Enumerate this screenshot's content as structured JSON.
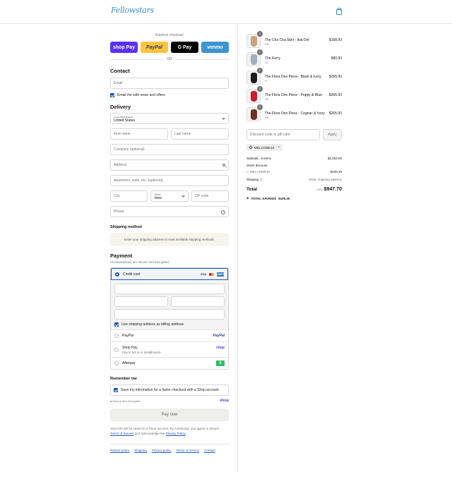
{
  "header": {
    "brand": "Fellowstars",
    "cart_icon": "shopping-bag-icon"
  },
  "express": {
    "label": "Express checkout",
    "or": "OR",
    "buttons": {
      "shop": "shop Pay",
      "paypal": "PayPal",
      "gpay": "G Pay",
      "venmo": "venmo"
    }
  },
  "contact": {
    "title": "Contact",
    "email_placeholder": "Email",
    "news_label": "Email me with news and offers"
  },
  "delivery": {
    "title": "Delivery",
    "country_label": "Country/Region",
    "country_value": "United States",
    "first_name": "First name",
    "last_name": "Last name",
    "company": "Company (optional)",
    "address": "Address",
    "apartment": "Apartment, suite, etc. (optional)",
    "city": "City",
    "state_label": "State",
    "state_value": "Iowa",
    "zip": "ZIP code",
    "phone": "Phone"
  },
  "shipping": {
    "title": "Shipping method",
    "info": "Enter your shipping address to view available shipping methods."
  },
  "payment": {
    "title": "Payment",
    "subtitle": "All transactions are secure and encrypted.",
    "credit_card": "Credit card",
    "cards": {
      "visa": "VISA",
      "amex": "AMEX"
    },
    "billing_label": "Use shipping address as billing address",
    "paypal": "PayPal",
    "paypal_logo": "PayPal",
    "shop_pay": "Shop Pay",
    "shop_pay_sub": "Pay in full or in installments",
    "shop_logo": "shop",
    "afterpay": "Afterpay",
    "afterpay_logo": "$"
  },
  "remember": {
    "title": "Remember me",
    "label": "Save my information for a faster checkout with a Shop account",
    "secure": "Secure and encrypted",
    "shop_logo": "shop"
  },
  "pay_now": "Pay now",
  "legal": {
    "text": "Your info will be saved to a Shop account. By continuing, you agree to Shop's",
    "tos": "Terms of Service",
    "and": "and acknowledge the",
    "privacy": "Privacy Policy",
    "dot": "."
  },
  "footer_links": [
    "Refund policy",
    "Shipping",
    "Privacy policy",
    "Terms of service",
    "Contact"
  ],
  "order": {
    "items": [
      {
        "name": "The Cha Cha Skirt - Ikat Dot",
        "variant": "XS",
        "price": "$168.00",
        "qty": "1",
        "color": "#c9a37a"
      },
      {
        "name": "The Kerry",
        "variant": "XL",
        "price": "$90.00",
        "qty": "1",
        "color": "#9fb0c3"
      },
      {
        "name": "The Flora One Piece - Black & Ivory",
        "variant": "S",
        "price": "$265.00",
        "qty": "1",
        "color": "#1b1b1b"
      },
      {
        "name": "The Flora One Piece - Poppy & Blue",
        "variant": "XS",
        "price": "$265.00",
        "qty": "1",
        "color": "#c8202a"
      },
      {
        "name": "The Flora One Piece - Cognac & Ivory",
        "variant": "XS",
        "price": "$265.00",
        "qty": "1",
        "color": "#6b3323"
      }
    ],
    "discount_placeholder": "Discount code or gift card",
    "apply": "Apply",
    "applied_code": "WELCOME10",
    "subtotal_label": "Subtotal · 5 items",
    "subtotal": "$1,053.00",
    "order_discount": "Order discount",
    "discount_code": "WELCOME10",
    "discount_value": "- $105.30",
    "shipping_label": "Shipping",
    "shipping_value": "Enter shipping address",
    "total_label": "Total",
    "currency": "USD",
    "total": "$947.70",
    "savings_label": "TOTAL SAVINGS",
    "savings": "$105.30"
  }
}
